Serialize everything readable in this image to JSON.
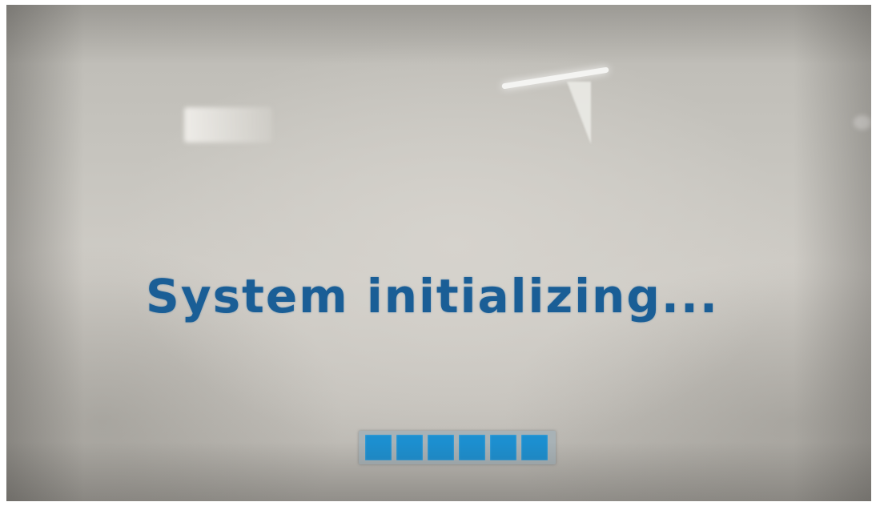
{
  "screen": {
    "status_message": "System initializing...",
    "progress": {
      "filled_blocks": 6,
      "total_blocks": 6
    },
    "colors": {
      "text": "#1a5e96",
      "progress_fill": "#1c8fd0",
      "background": "#c8c5bf"
    }
  }
}
